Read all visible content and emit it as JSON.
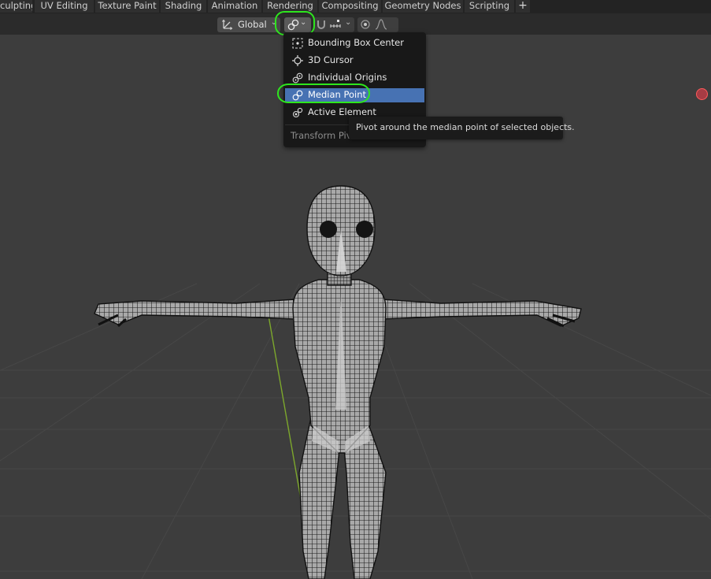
{
  "workspace_tabs": [
    {
      "label": "culpting"
    },
    {
      "label": "UV Editing"
    },
    {
      "label": "Texture Paint"
    },
    {
      "label": "Shading"
    },
    {
      "label": "Animation"
    },
    {
      "label": "Rendering"
    },
    {
      "label": "Compositing"
    },
    {
      "label": "Geometry Nodes"
    },
    {
      "label": "Scripting"
    },
    {
      "label": "+"
    }
  ],
  "header": {
    "orientation": {
      "label": "Global",
      "icon": "transform-orientation-icon"
    },
    "pivot": {
      "icon": "median-point-icon",
      "selected": "Median Point"
    },
    "snapping": {
      "icons": [
        "snap-toggle-icon",
        "snap-increment-icon"
      ]
    },
    "proportional": {
      "icons": [
        "proportional-edit-icon",
        "falloff-curve-icon"
      ]
    }
  },
  "pivot_menu": {
    "items": [
      {
        "label": "Bounding Box Center",
        "icon": "bounding-box-center-icon"
      },
      {
        "label": "3D Cursor",
        "icon": "3d-cursor-icon"
      },
      {
        "label": "Individual Origins",
        "icon": "individual-origins-icon"
      },
      {
        "label": "Median Point",
        "icon": "median-point-icon",
        "active": true
      },
      {
        "label": "Active Element",
        "icon": "active-element-icon"
      }
    ],
    "title": "Transform Pivot Point"
  },
  "tooltip": {
    "text": "Pivot around the median point of selected objects."
  },
  "colors": {
    "highlight": "#4772b3",
    "annotation": "#2ee61e",
    "background": "#3d3d3d",
    "menu_bg": "#181818"
  }
}
